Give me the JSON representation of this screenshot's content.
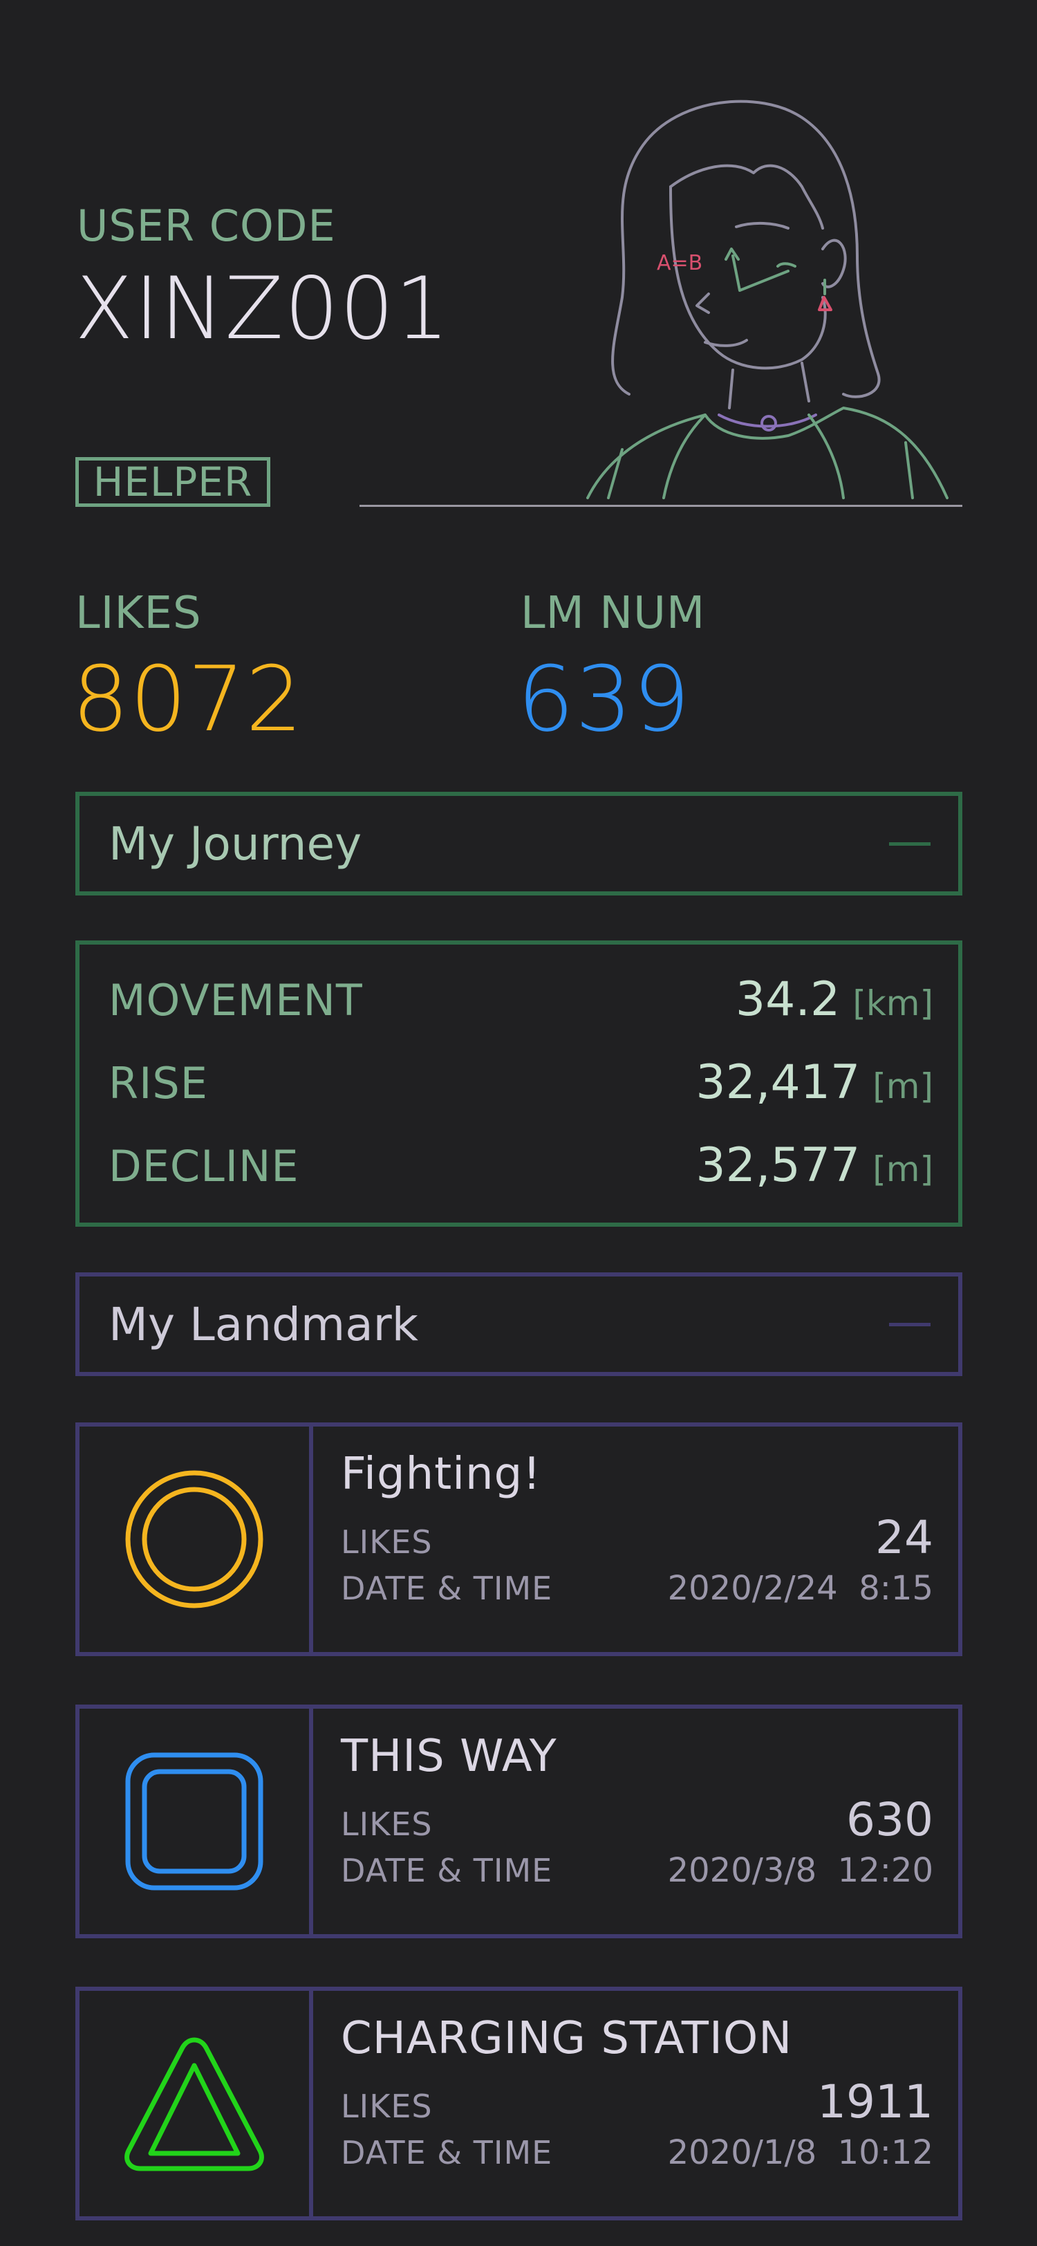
{
  "profile": {
    "user_code_label": "USER CODE",
    "user_code": "XINZ001",
    "role_badge": "HELPER"
  },
  "stats": {
    "likes_label": "LIKES",
    "likes_value": "8072",
    "lm_label": "LM NUM",
    "lm_value": "639"
  },
  "journey": {
    "title": "My Journey",
    "rows": [
      {
        "label": "MOVEMENT",
        "value": "34.2",
        "unit": "[km]"
      },
      {
        "label": "RISE",
        "value": "32,417",
        "unit": "[m]"
      },
      {
        "label": "DECLINE",
        "value": "32,577",
        "unit": "[m]"
      }
    ]
  },
  "landmark": {
    "title": "My Landmark",
    "cards": [
      {
        "icon": "circle-icon",
        "title": "Fighting!",
        "likes_label": "LIKES",
        "likes": "24",
        "date_label": "DATE & TIME",
        "date": "2020/2/24  8:15"
      },
      {
        "icon": "square-icon",
        "title": "THIS WAY",
        "likes_label": "LIKES",
        "likes": "630",
        "date_label": "DATE & TIME",
        "date": "2020/3/8  12:20"
      },
      {
        "icon": "triangle-icon",
        "title": "CHARGING STATION",
        "likes_label": "LIKES",
        "likes": "1911",
        "date_label": "DATE & TIME",
        "date": "2020/1/8  10:12"
      }
    ]
  },
  "avatar_annotation": "A=B",
  "colors": {
    "background": "#202022",
    "accent_green": "#7fae8e",
    "likes_yellow": "#f5b51f",
    "lm_blue": "#2f8ef0",
    "journey_border": "#2e6b47",
    "landmark_border": "#403a6e",
    "icon_circle": "#f5b51f",
    "icon_square": "#2f8ef0",
    "icon_triangle": "#22d41a"
  }
}
